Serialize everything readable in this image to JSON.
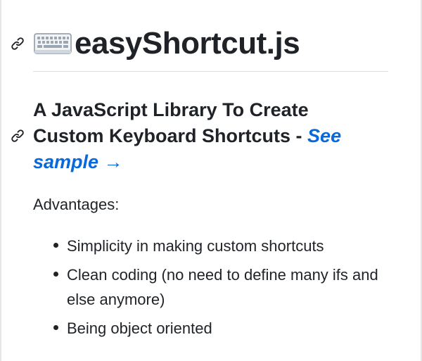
{
  "heading": {
    "icon": "keyboard-icon",
    "title": "easyShortcut.js"
  },
  "subheading": {
    "text": "A JavaScript Library To Create Custom Keyboard Shortcuts - ",
    "link_text": "See sample →"
  },
  "intro": "Advantages:",
  "advantages": [
    "Simplicity in making custom shortcuts",
    "Clean coding (no need to define many ifs and else anymore)",
    "Being object oriented"
  ],
  "icons": {
    "anchor": "link-icon"
  },
  "colors": {
    "text": "#1f2328",
    "link": "#0969da",
    "divider": "#d8dee4"
  }
}
